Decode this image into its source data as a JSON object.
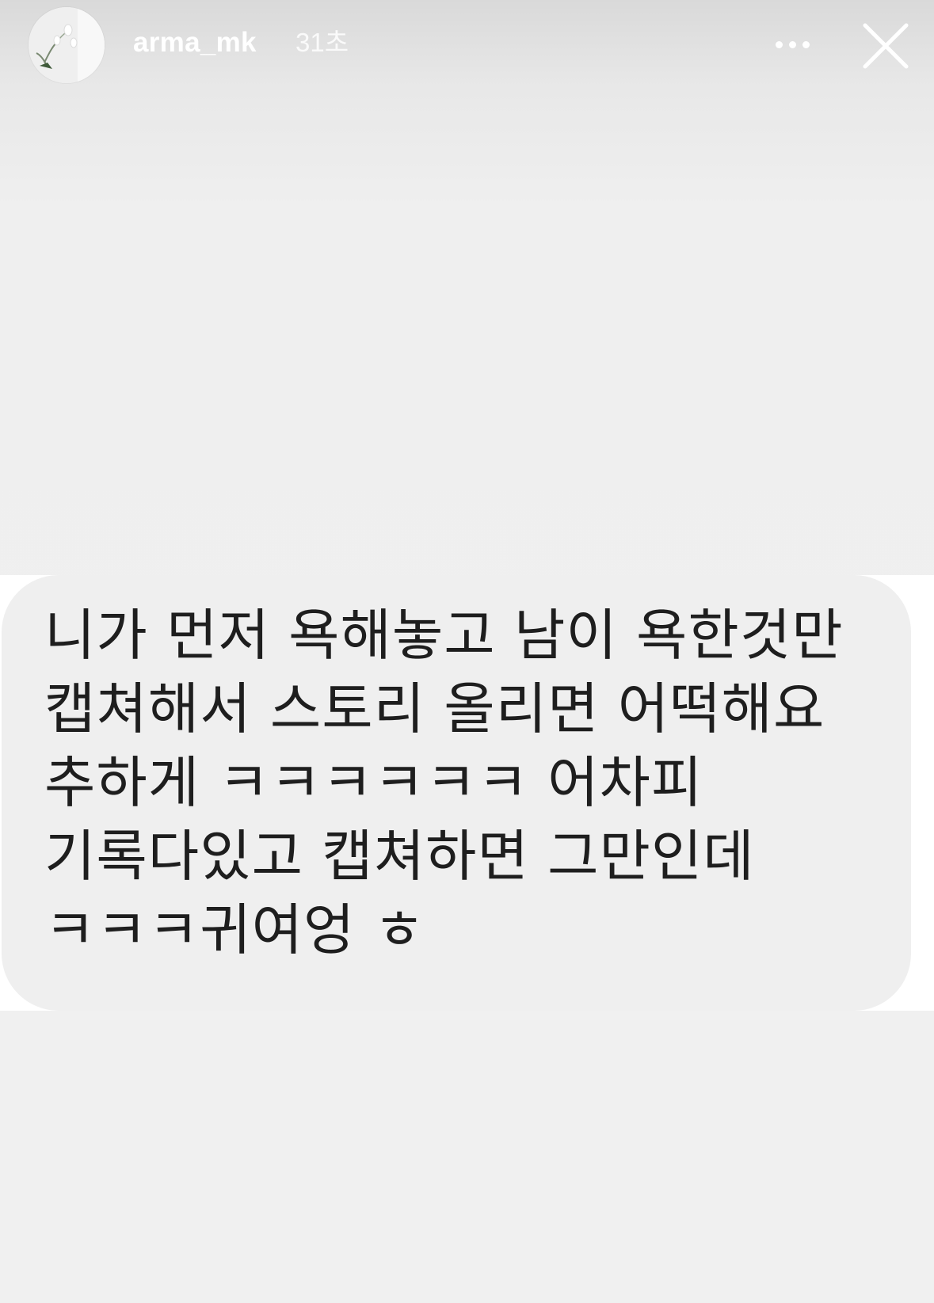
{
  "story": {
    "username": "arma_mk",
    "time": "31초",
    "more_icon": "more-horizontal-icon",
    "close_icon": "close-icon",
    "avatar_icon": "profile-avatar"
  },
  "message": {
    "lines": [
      "니가 먼저 욕해놓고 남이 욕한것만",
      "캡쳐해서 스토리 올리면 어떡해요",
      "추하게 ㅋㅋㅋㅋㅋㅋ 어차피",
      "기록다있고 캡쳐하면 그만인데",
      "ㅋㅋㅋ귀여엉 ㅎ"
    ]
  },
  "colors": {
    "background": "#efefef",
    "bubble": "#efefef",
    "band": "#ffffff",
    "text": "#1e1e1e",
    "header_text": "#ffffff"
  }
}
